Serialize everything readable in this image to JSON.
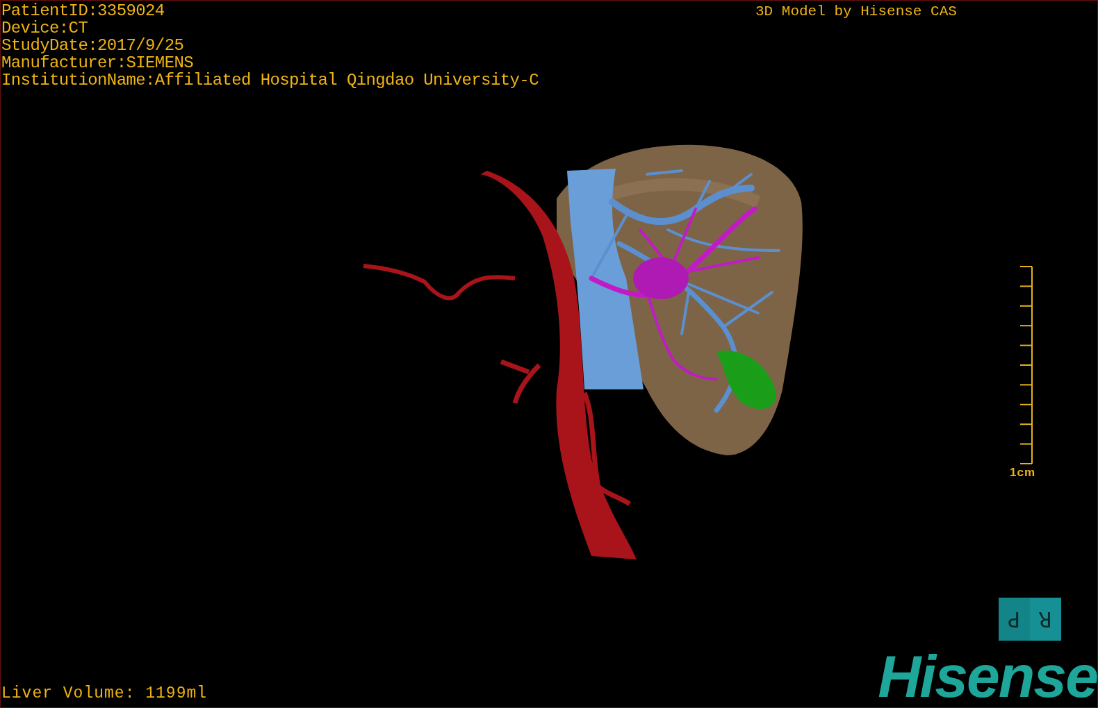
{
  "patient_info": [
    "PatientID:3359024",
    "Device:CT",
    "StudyDate:2017/9/25",
    "Manufacturer:SIEMENS",
    "InstitutionName:Affiliated Hospital Qingdao University-C"
  ],
  "title": "3D Model by Hisense CAS",
  "scale_bar": {
    "label": "1cm"
  },
  "orientation_cube": {
    "faces": [
      {
        "label": "P"
      },
      {
        "label": "R"
      }
    ]
  },
  "liver_volume": "Liver Volume: 1199ml",
  "logo": "Hisense"
}
